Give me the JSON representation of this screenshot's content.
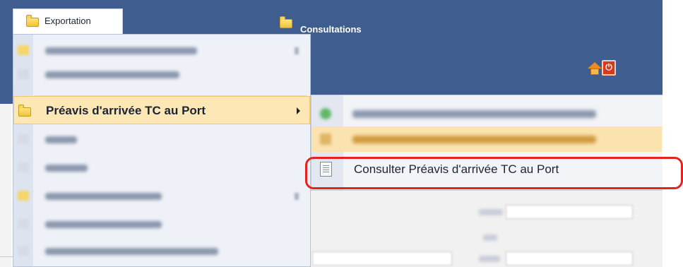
{
  "header": {
    "export_menu_label": "Exportation",
    "consultations_menu_label": "Consultations",
    "home_icon": "home-icon",
    "power_icon": "power-icon",
    "power_glyph": "⏻"
  },
  "dropdown": {
    "active_item_label": "Préavis d'arrivée TC au Port",
    "active_item_arrow": "▶"
  },
  "submenu": {
    "consult_item_label": "Consulter Préavis d'arrivée TC au Port"
  },
  "colors": {
    "header_blue": "#3f5e8f",
    "menu_hover": "#fde7b5",
    "highlight_red": "#e3231f"
  }
}
